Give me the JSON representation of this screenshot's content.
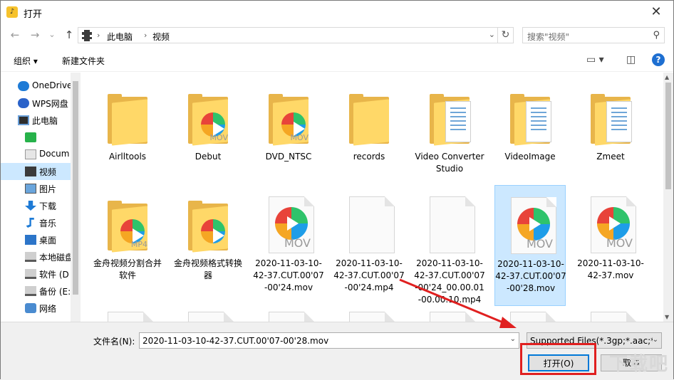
{
  "window": {
    "title": "打开",
    "close_glyph": "✕"
  },
  "nav": {
    "back": "←",
    "forward": "→",
    "recent": "⌄",
    "up": "↑",
    "breadcrumbs": [
      "此电脑",
      "视频"
    ],
    "search_placeholder": "搜索\"视频\""
  },
  "toolbar": {
    "organize": "组织 ▾",
    "new_folder": "新建文件夹",
    "help": "?"
  },
  "sidebar": {
    "items": [
      {
        "label": "OneDrive",
        "icon": "cloud-icon"
      },
      {
        "label": "WPS网盘",
        "icon": "wps-cloud-icon"
      },
      {
        "label": "此电脑",
        "icon": "computer-icon"
      },
      {
        "label": "",
        "icon": "green-app-icon"
      },
      {
        "label": "Docum",
        "icon": "documents-icon"
      },
      {
        "label": "视频",
        "icon": "video-folder-icon",
        "selected": true
      },
      {
        "label": "图片",
        "icon": "pictures-icon"
      },
      {
        "label": "下载",
        "icon": "download-icon"
      },
      {
        "label": "音乐",
        "icon": "music-icon"
      },
      {
        "label": "桌面",
        "icon": "desktop-icon"
      },
      {
        "label": "本地磁盘",
        "icon": "drive-icon"
      },
      {
        "label": "软件 (D",
        "icon": "drive-icon"
      },
      {
        "label": "备份 (E:",
        "icon": "drive-icon"
      },
      {
        "label": "网络",
        "icon": "network-icon"
      }
    ]
  },
  "files": [
    {
      "name": "Airlltools",
      "kind": "folder"
    },
    {
      "name": "Debut",
      "kind": "folder-mov"
    },
    {
      "name": "DVD_NTSC",
      "kind": "folder-mov"
    },
    {
      "name": "records",
      "kind": "folder"
    },
    {
      "name": "Video Converter Studio",
      "kind": "folder-doc"
    },
    {
      "name": "VideoImage",
      "kind": "folder-doc"
    },
    {
      "name": "Zmeet",
      "kind": "folder-doc"
    },
    {
      "name": "金舟视频分割合并软件",
      "kind": "folder-mp4"
    },
    {
      "name": "金舟视频格式转换器",
      "kind": "folder-play"
    },
    {
      "name": "2020-11-03-10-42-37.CUT.00'07-00'24.mov",
      "kind": "mov"
    },
    {
      "name": "2020-11-03-10-42-37.CUT.00'07-00'24.mp4",
      "kind": "blank"
    },
    {
      "name": "2020-11-03-10-42-37.CUT.00'07-00'24_00.00.01-00.00.10.mp4",
      "kind": "blank"
    },
    {
      "name": "2020-11-03-10-42-37.CUT.00'07-00'28.mov",
      "kind": "mov",
      "selected": true
    },
    {
      "name": "2020-11-03-10-42-37.mov",
      "kind": "mov"
    }
  ],
  "file_labels": {
    "mov": "MOV",
    "mp4": "MP4"
  },
  "bottom": {
    "filename_label": "文件名(N):",
    "filename_value": "2020-11-03-10-42-37.CUT.00'07-00'28.mov",
    "filetype_value": "Supported Files(*.3gp;*.aac;*",
    "open_label": "打开(O)",
    "cancel_label": "取消"
  },
  "watermark": "下载吧",
  "colors": {
    "selection": "#cce8ff",
    "accent": "#0078d7",
    "annotation": "#e02020"
  }
}
